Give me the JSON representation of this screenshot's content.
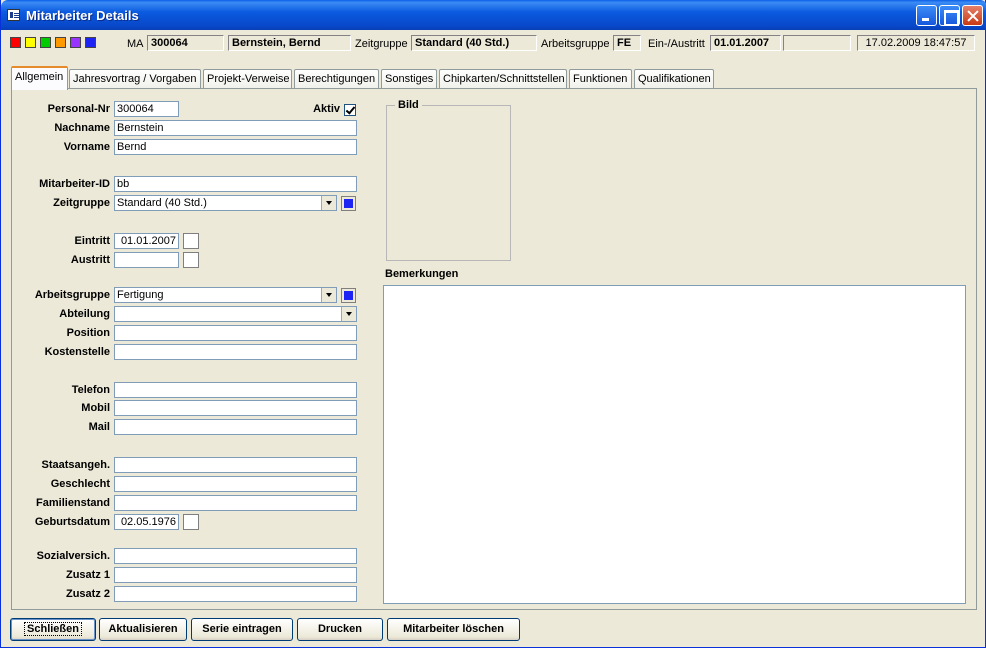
{
  "window": {
    "title": "Mitarbeiter Details"
  },
  "infobar": {
    "swatch_colors": [
      "#ff0000",
      "#ffff00",
      "#00cc00",
      "#ff9900",
      "#9933ff",
      "#1d23f2"
    ],
    "ma_label": "MA",
    "ma_value": "300064",
    "name_value": "Bernstein, Bernd",
    "zeitgruppe_label": "Zeitgruppe",
    "zeitgruppe_value": "Standard (40 Std.)",
    "arbeitsgruppe_label": "Arbeitsgruppe",
    "arbeitsgruppe_value": "FE",
    "einaustritt_label": "Ein-/Austritt",
    "eintritt_value": "01.01.2007",
    "austritt_value": "",
    "timestamp": "17.02.2009 18:47:57"
  },
  "tabs": [
    {
      "label": "Allgemein"
    },
    {
      "label": "Jahresvortrag / Vorgaben"
    },
    {
      "label": "Projekt-Verweise"
    },
    {
      "label": "Berechtigungen"
    },
    {
      "label": "Sonstiges"
    },
    {
      "label": "Chipkarten/Schnittstellen"
    },
    {
      "label": "Funktionen"
    },
    {
      "label": "Qualifikationen"
    }
  ],
  "form": {
    "personal_nr": {
      "label": "Personal-Nr",
      "value": "300064"
    },
    "aktiv": {
      "label": "Aktiv",
      "checked": true
    },
    "nachname": {
      "label": "Nachname",
      "value": "Bernstein"
    },
    "vorname": {
      "label": "Vorname",
      "value": "Bernd"
    },
    "mitarbeiter_id": {
      "label": "Mitarbeiter-ID",
      "value": "bb"
    },
    "zeitgruppe": {
      "label": "Zeitgruppe",
      "value": "Standard (40 Std.)"
    },
    "eintritt": {
      "label": "Eintritt",
      "value": "01.01.2007"
    },
    "austritt": {
      "label": "Austritt",
      "value": ""
    },
    "arbeitsgruppe": {
      "label": "Arbeitsgruppe",
      "value": "Fertigung"
    },
    "abteilung": {
      "label": "Abteilung",
      "value": ""
    },
    "position": {
      "label": "Position",
      "value": ""
    },
    "kostenstelle": {
      "label": "Kostenstelle",
      "value": ""
    },
    "telefon": {
      "label": "Telefon",
      "value": ""
    },
    "mobil": {
      "label": "Mobil",
      "value": ""
    },
    "mail": {
      "label": "Mail",
      "value": ""
    },
    "staatsangeh": {
      "label": "Staatsangeh.",
      "value": ""
    },
    "geschlecht": {
      "label": "Geschlecht",
      "value": ""
    },
    "familienstand": {
      "label": "Familienstand",
      "value": ""
    },
    "geburtsdatum": {
      "label": "Geburtsdatum",
      "value": "02.05.1976"
    },
    "sozialversich": {
      "label": "Sozialversich.",
      "value": ""
    },
    "zusatz1": {
      "label": "Zusatz 1",
      "value": ""
    },
    "zusatz2": {
      "label": "Zusatz 2",
      "value": ""
    }
  },
  "bild": {
    "label": "Bild"
  },
  "bemerkungen": {
    "label": "Bemerkungen",
    "value": ""
  },
  "buttons": {
    "schliessen": "Schließen",
    "aktualisieren": "Aktualisieren",
    "serie": "Serie eintragen",
    "drucken": "Drucken",
    "loeschen": "Mitarbeiter löschen"
  },
  "colors": {
    "accent_blue": "#1d23f2",
    "title_blue": "#0b5be0",
    "tab_active_highlight": "#e68b2c"
  }
}
